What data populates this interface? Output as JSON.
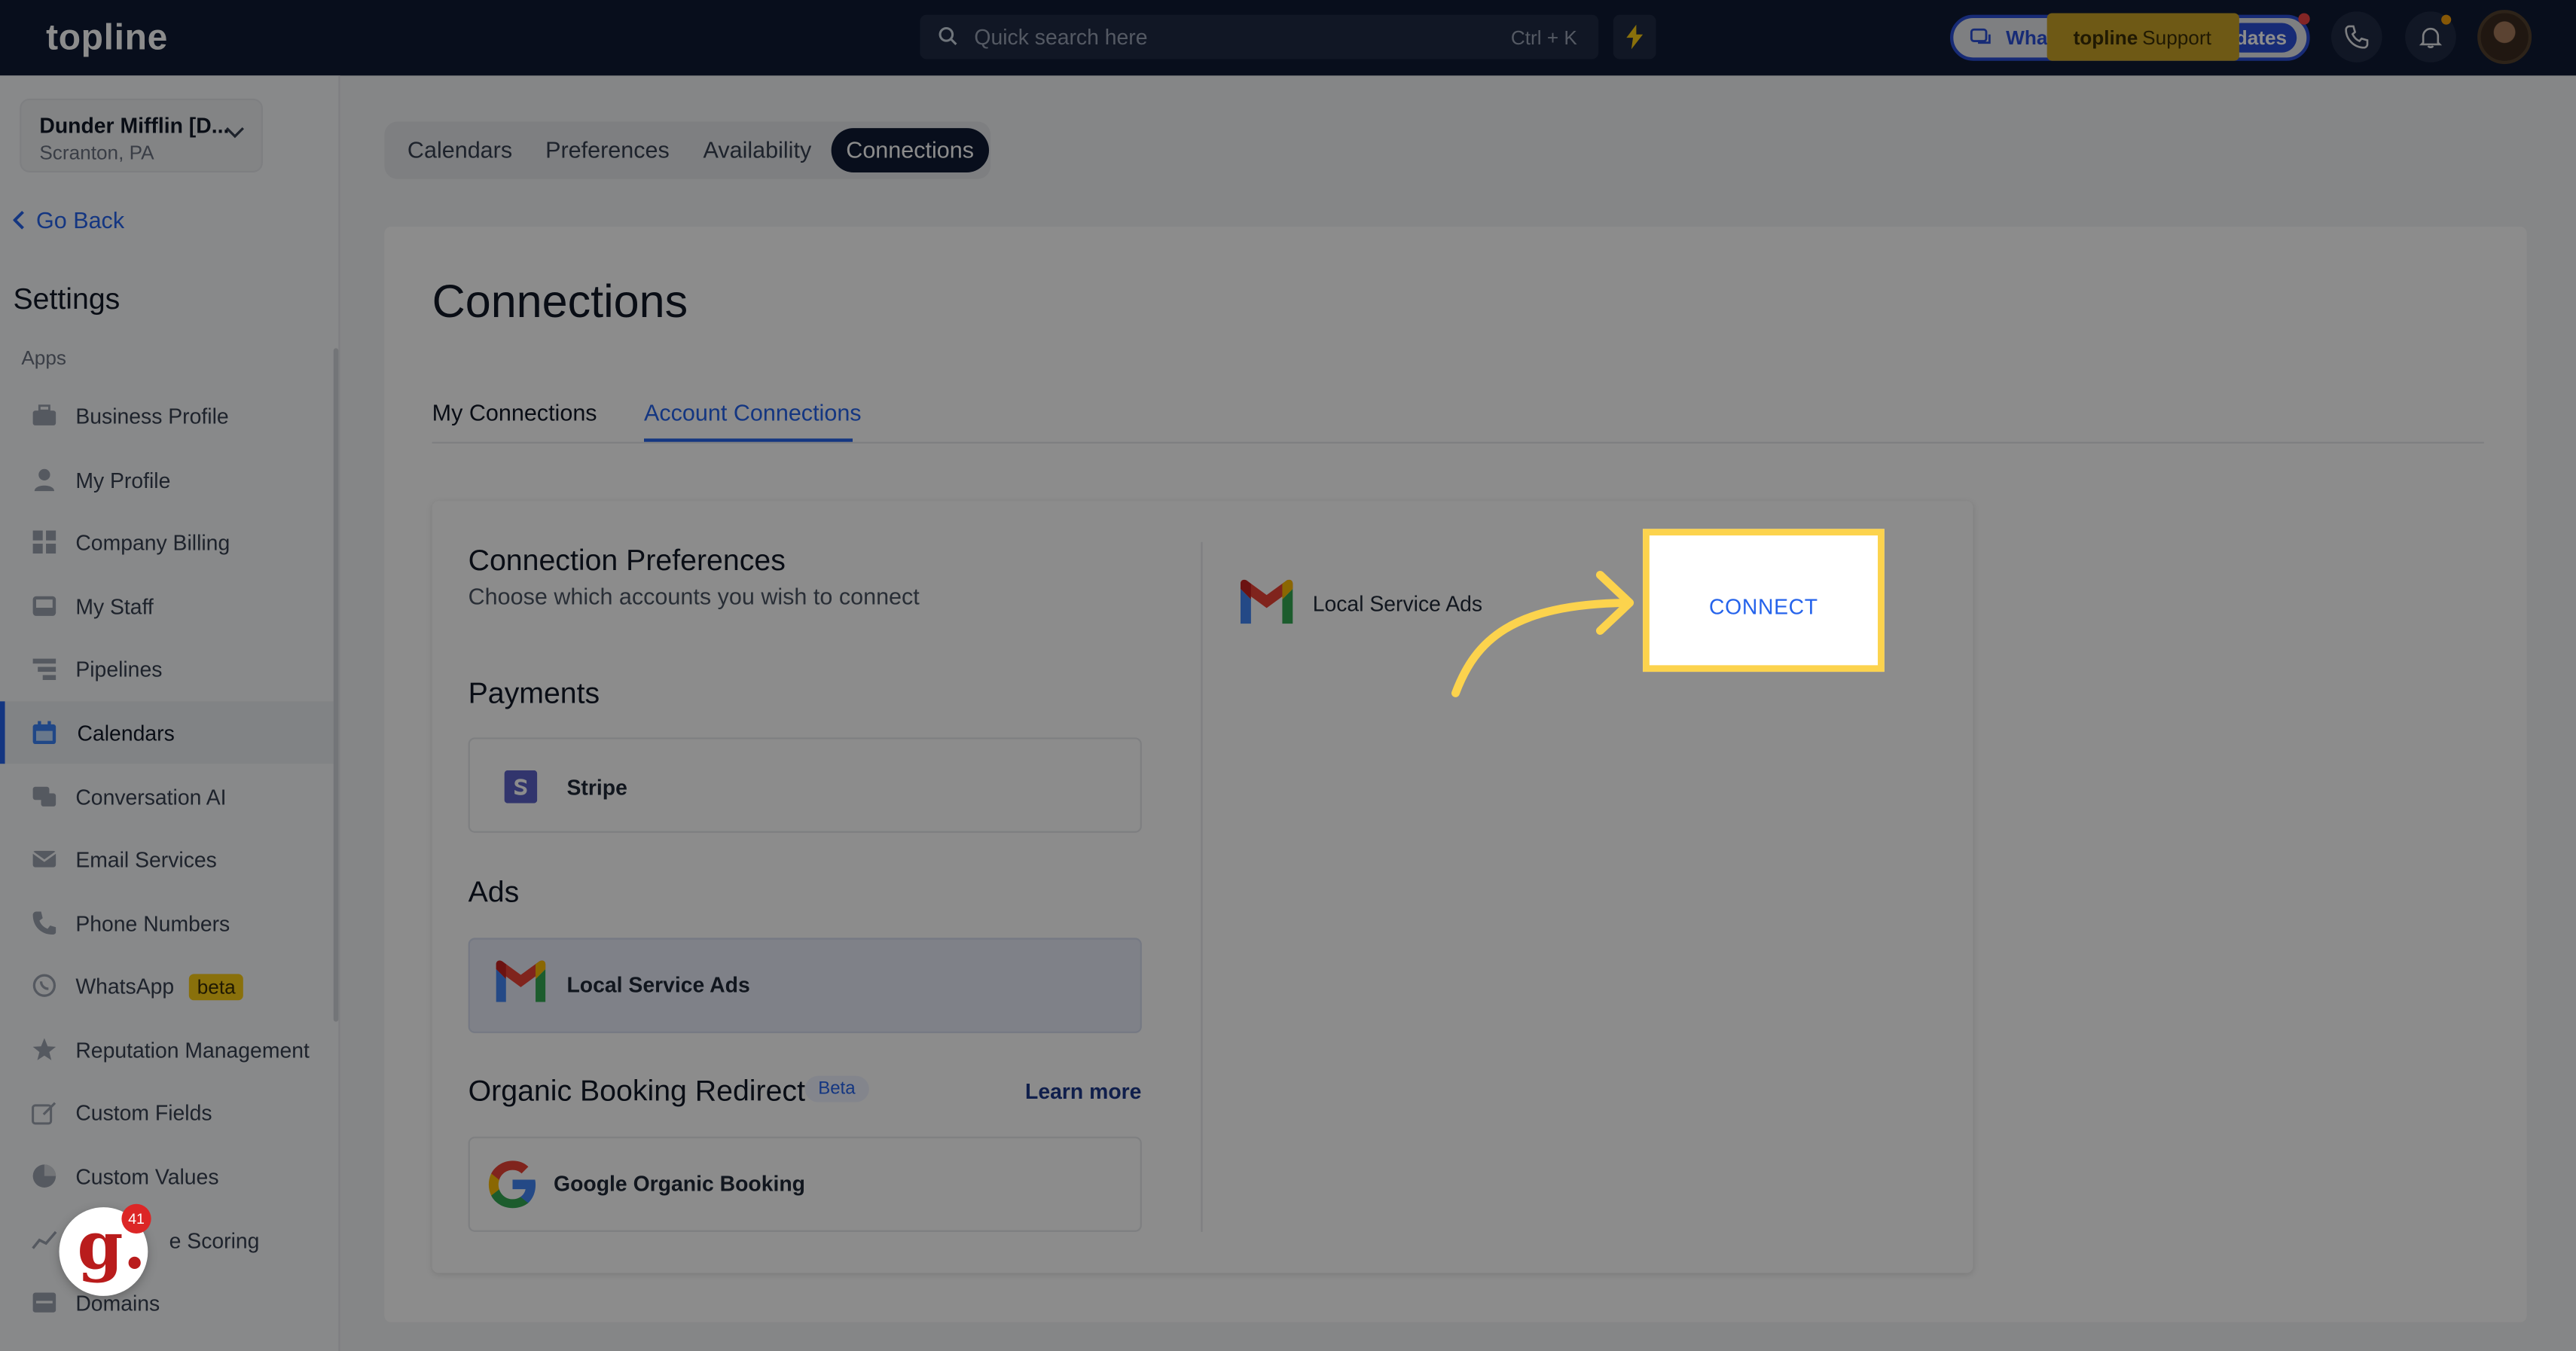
{
  "topbar": {
    "logo": "topline",
    "search_placeholder": "Quick search here",
    "search_shortcut": "Ctrl + K",
    "whats_new_left": "What",
    "whats_new_right": "dates",
    "support_brand": "topline",
    "support_word": "Support"
  },
  "account": {
    "name": "Dunder Mifflin [D...",
    "location": "Scranton, PA"
  },
  "sidebar": {
    "go_back": "Go Back",
    "title": "Settings",
    "section": "Apps",
    "items": [
      {
        "label": "Business Profile",
        "icon": "briefcase-icon"
      },
      {
        "label": "My Profile",
        "icon": "user-icon"
      },
      {
        "label": "Company Billing",
        "icon": "grid-icon"
      },
      {
        "label": "My Staff",
        "icon": "inbox-icon"
      },
      {
        "label": "Pipelines",
        "icon": "filter-icon"
      },
      {
        "label": "Calendars",
        "icon": "calendar-icon"
      },
      {
        "label": "Conversation AI",
        "icon": "chat-icon"
      },
      {
        "label": "Email Services",
        "icon": "mail-icon"
      },
      {
        "label": "Phone Numbers",
        "icon": "phone-icon"
      },
      {
        "label": "WhatsApp",
        "icon": "whatsapp-icon",
        "badge": "beta"
      },
      {
        "label": "Reputation Management",
        "icon": "star-icon"
      },
      {
        "label": "Custom Fields",
        "icon": "edit-icon"
      },
      {
        "label": "Custom Values",
        "icon": "pie-icon"
      },
      {
        "label": "e Scoring",
        "icon": "chart-icon"
      },
      {
        "label": "Domains",
        "icon": "server-icon"
      }
    ]
  },
  "tabs": [
    "Calendars",
    "Preferences",
    "Availability",
    "Connections"
  ],
  "main": {
    "title": "Connections",
    "subtabs": [
      "My Connections",
      "Account Connections"
    ],
    "pref_title": "Connection Preferences",
    "pref_sub": "Choose which accounts you wish to connect",
    "payments_h": "Payments",
    "stripe": "Stripe",
    "ads_h": "Ads",
    "lsa": "Local Service Ads",
    "organic_h": "Organic Booking Redirect",
    "beta": "Beta",
    "learn_more": "Learn more",
    "google_organic": "Google Organic Booking",
    "right_lsa": "Local Service Ads",
    "connect": "CONNECT"
  },
  "badge": {
    "count": "41"
  },
  "colors": {
    "accent": "#2563eb",
    "highlight": "#fcd34d",
    "nav_dark": "#0f1a33"
  }
}
